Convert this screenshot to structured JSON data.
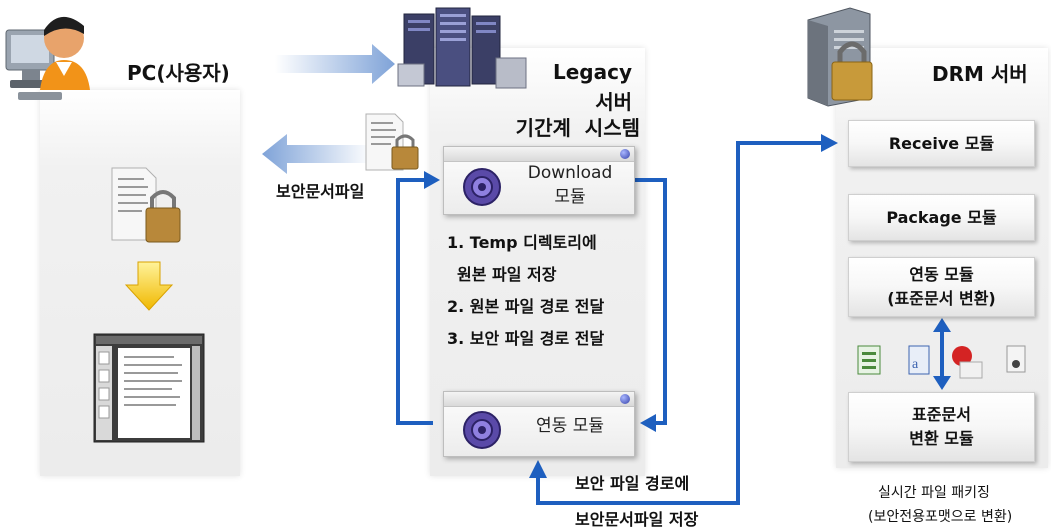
{
  "pc_panel": {
    "title": "PC(사용자)"
  },
  "legacy_panel": {
    "title_line1": "Legacy",
    "title_line2": "서버",
    "title_line3": "기간계  시스템"
  },
  "drm_panel": {
    "title": "DRM 서버"
  },
  "modules": {
    "download_line1": "Download",
    "download_line2": "모듈",
    "sync": "연동 모듈"
  },
  "steps": [
    "1. Temp 디렉토리에",
    "원본 파일 저장",
    "2. 원본 파일 경로 전달",
    "3. 보안 파일 경로 전달"
  ],
  "drm_modules": {
    "receive": "Receive 모듈",
    "package": "Package 모듈",
    "sync_line1": "연동 모듈",
    "sync_line2": "(표준문서 변환)",
    "convert_line1": "표준문서",
    "convert_line2": "변환 모듈"
  },
  "labels": {
    "secure_file": "보안문서파일",
    "bottom_line1": "보안 파일 경로에",
    "bottom_line2": "보안문서파일 저장",
    "drm_caption1": "실시간 파일 패키징",
    "drm_caption2": "(보안전용포맷으로 변환)"
  },
  "colors": {
    "arrow_blue": "#1e5fbf",
    "light_arrow": "#8fb0dd",
    "down_arrow": "#f2c200"
  }
}
